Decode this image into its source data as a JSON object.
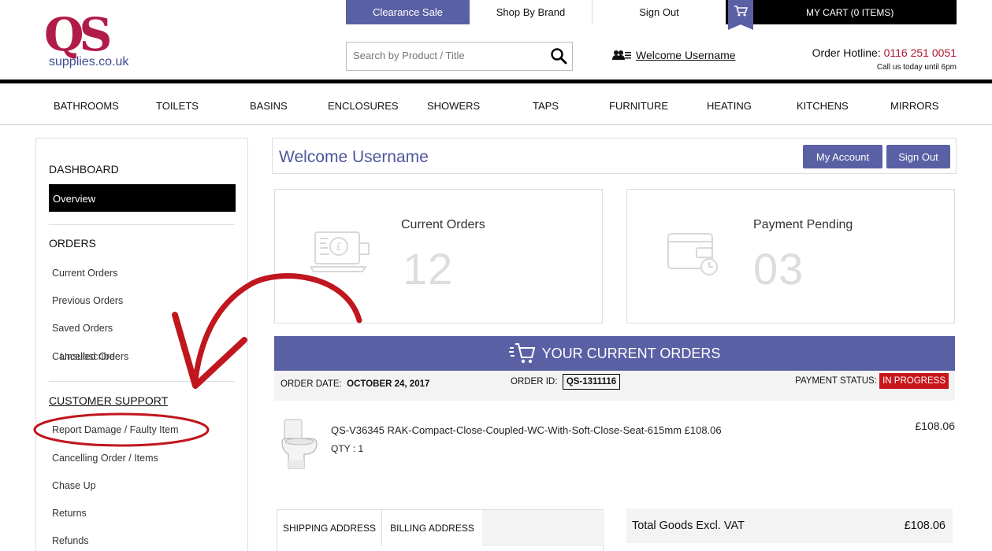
{
  "header": {
    "logo_text": "supplies.co.uk",
    "logo_letters": "QS",
    "top_nav": [
      "Clearance Sale",
      "Shop By Brand",
      "Sign Out"
    ],
    "cart_label": "MY CART (0 ITEMS)",
    "search_placeholder": "Search by Product / Title",
    "welcome_link": "Welcome Username",
    "hotline_label": "Order Hotline:",
    "hotline_number": "0116 251 0051",
    "hotline_note": "Call us today until 6pm"
  },
  "categories": [
    "BATHROOMS",
    "TOILETS",
    "BASINS",
    "ENCLOSURES",
    "SHOWERS",
    "TAPS",
    "FURNITURE",
    "HEATING",
    "KITCHENS",
    "MIRRORS"
  ],
  "sidebar": {
    "dashboard_heading": "DASHBOARD",
    "overview": "Overview",
    "orders_heading": "ORDERS",
    "orders_items": [
      "Current Orders",
      "Previous Orders",
      "Saved Orders",
      "Cancelled Orders"
    ],
    "overlap_text": "Unsubscribe",
    "support_heading": "CUSTOMER SUPPORT",
    "support_items": [
      "Report Damage / Faulty Item",
      "Cancelling Order / Items",
      "Chase Up",
      "Returns",
      "Refunds"
    ]
  },
  "main": {
    "welcome_title": "Welcome  Username",
    "my_account_button": "My Account",
    "sign_out_button": "Sign Out",
    "current_orders_label": "Current Orders",
    "current_orders_count": "12",
    "payment_pending_label": "Payment Pending",
    "payment_pending_count": "03",
    "orders_bar_title": "YOUR CURRENT ORDERS",
    "order_date_label": "ORDER DATE:",
    "order_date": "OCTOBER 24, 2017",
    "order_id_label": "ORDER ID:",
    "order_id": "QS-1311116",
    "payment_status_label": "PAYMENT STATUS:",
    "payment_status": "IN PROGRESS",
    "product_name": "QS-V36345 RAK-Compact-Close-Coupled-WC-With-Soft-Close-Seat-615mm  £108.06",
    "product_qty": "QTY : 1",
    "product_price": "£108.06",
    "shipping_tab": "SHIPPING ADDRESS",
    "billing_tab": "BILLING ADDRESS",
    "total_label": "Total Goods Excl. VAT",
    "total_value": "£108.06"
  },
  "colors": {
    "accent": "#5a60a4",
    "status_red": "#c8161d",
    "annotation_red": "#c0161d"
  }
}
